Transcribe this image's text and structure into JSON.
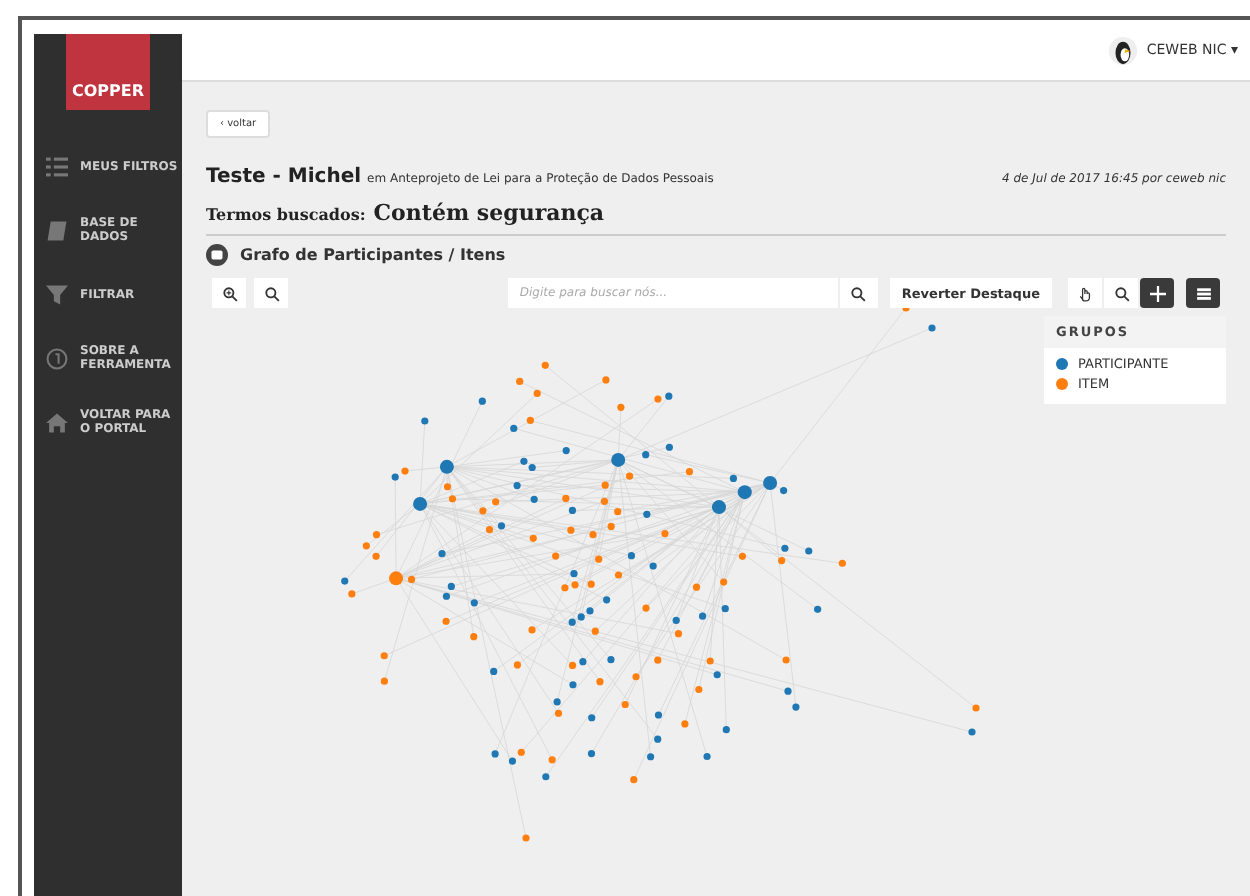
{
  "sidebar": {
    "logo": "COPPER",
    "items": [
      {
        "label": "MEUS FILTROS"
      },
      {
        "label": "BASE DE DADOS"
      },
      {
        "label": "FILTRAR"
      },
      {
        "label": "SOBRE A FERRAMENTA"
      },
      {
        "label": "VOLTAR PARA O PORTAL"
      }
    ]
  },
  "user": {
    "name": "CEWEB NIC",
    "caret": "▾"
  },
  "back_button": "‹ voltar",
  "title": "Teste - Michel",
  "subtitle": "em Anteprojeto de Lei para a Proteção de Dados Pessoais",
  "meta": "4 de Jul de 2017 16:45 por ceweb nic",
  "search_terms": {
    "label": "Termos buscados:",
    "value": "Contém segurança"
  },
  "graph": {
    "title": "Grafo de Participantes / Itens",
    "search": {
      "placeholder": "Digite para buscar nós..."
    },
    "revert_button": "Reverter Destaque",
    "modes": [
      {
        "selected": false
      },
      {
        "selected": false
      },
      {
        "selected": true
      }
    ],
    "legend_open": true,
    "legend": {
      "title": "GRUPOS",
      "groups": [
        {
          "label": "PARTICIPANTE",
          "color": "#1f77b4"
        },
        {
          "label": "ITEM",
          "color": "#ff7f0e"
        }
      ]
    }
  }
}
